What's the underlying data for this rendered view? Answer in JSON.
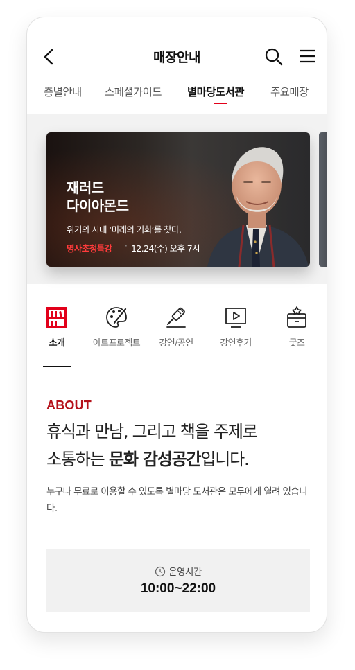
{
  "header": {
    "title": "매장안내",
    "back_icon": "chevron-left-icon",
    "search_icon": "search-icon",
    "menu_icon": "hamburger-menu-icon"
  },
  "tabs": [
    {
      "label": "층별안내",
      "active": false
    },
    {
      "label": "스페셜가이드",
      "active": false
    },
    {
      "label": "별마당도서관",
      "active": true
    },
    {
      "label": "주요매장",
      "active": false
    }
  ],
  "banner": {
    "name_line1": "재러드",
    "name_line2": "다이아몬드",
    "subtitle": "위기의 시대 ‘미래의 기회’를 찾다.",
    "tag": "명사초청특강",
    "separator": "·",
    "date": "12.24(수) 오후 7시"
  },
  "icon_tabs": [
    {
      "label": "소개",
      "icon": "bookshelf-icon",
      "active": true
    },
    {
      "label": "아트프로젝트",
      "icon": "palette-icon",
      "active": false
    },
    {
      "label": "강연/공연",
      "icon": "microphone-icon",
      "active": false
    },
    {
      "label": "강연후기",
      "icon": "video-play-icon",
      "active": false
    },
    {
      "label": "굿즈",
      "icon": "goods-box-icon",
      "active": false
    }
  ],
  "about": {
    "label": "ABOUT",
    "line1": "휴식과 만남, 그리고 책을 주제로",
    "line2_pre": "소통하는 ",
    "line2_bold": "문화 감성공간",
    "line2_post": "입니다.",
    "description": "누구나 무료로 이용할 수 있도록 별마당 도서관은 모두에게 열려 있습니다."
  },
  "hours": {
    "icon": "clock-icon",
    "label": "운영시간",
    "value": "10:00~22:00"
  },
  "colors": {
    "accent": "#e2001a",
    "about_red": "#b5121b",
    "banner_tag": "#ff3b3b"
  }
}
